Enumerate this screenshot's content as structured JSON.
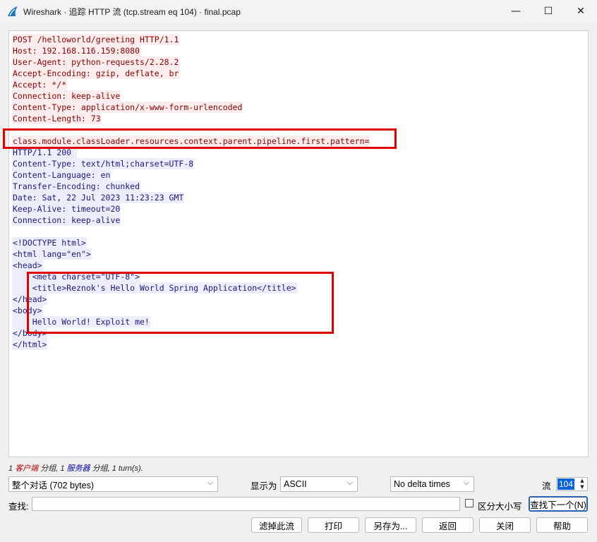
{
  "window": {
    "title": "Wireshark · 追踪 HTTP 流 (tcp.stream eq 104) · final.pcap",
    "controls": {
      "minimize": "—",
      "maximize": "☐",
      "close": "✕"
    }
  },
  "stream": {
    "lines": [
      {
        "text": "POST /helloworld/greeting HTTP/1.1",
        "side": "client"
      },
      {
        "text": "Host: 192.168.116.159:8080",
        "side": "client"
      },
      {
        "text": "User-Agent: python-requests/2.28.2",
        "side": "client"
      },
      {
        "text": "Accept-Encoding: gzip, deflate, br",
        "side": "client"
      },
      {
        "text": "Accept: */*",
        "side": "client"
      },
      {
        "text": "Connection: keep-alive",
        "side": "client"
      },
      {
        "text": "Content-Type: application/x-www-form-urlencoded",
        "side": "client"
      },
      {
        "text": "Content-Length: 73",
        "side": "client"
      },
      {
        "text": "",
        "side": "blank"
      },
      {
        "text": "class.module.classLoader.resources.context.parent.pipeline.first.pattern=",
        "side": "client"
      },
      {
        "text": "HTTP/1.1 200 ",
        "side": "server"
      },
      {
        "text": "Content-Type: text/html;charset=UTF-8",
        "side": "server"
      },
      {
        "text": "Content-Language: en",
        "side": "server"
      },
      {
        "text": "Transfer-Encoding: chunked",
        "side": "server"
      },
      {
        "text": "Date: Sat, 22 Jul 2023 11:23:23 GMT",
        "side": "server"
      },
      {
        "text": "Keep-Alive: timeout=20",
        "side": "server"
      },
      {
        "text": "Connection: keep-alive",
        "side": "server"
      },
      {
        "text": "",
        "side": "blank"
      },
      {
        "text": "<!DOCTYPE html>",
        "side": "server"
      },
      {
        "text": "<html lang=\"en\">",
        "side": "server"
      },
      {
        "text": "<head>",
        "side": "server"
      },
      {
        "text": "    <meta charset=\"UTF-8\">",
        "side": "server"
      },
      {
        "text": "    <title>Reznok's Hello World Spring Application</title>",
        "side": "server"
      },
      {
        "text": "</head>",
        "side": "server"
      },
      {
        "text": "<body>",
        "side": "server"
      },
      {
        "text": "    Hello World! Exploit me!",
        "side": "server"
      },
      {
        "text": "</body>",
        "side": "server"
      },
      {
        "text": "</html>",
        "side": "server"
      }
    ]
  },
  "summary": {
    "client_count": "1",
    "client_label": "客户端",
    "packets1": " 分组, ",
    "server_count": "1",
    "server_label": "服务器",
    "packets2": " 分组, ",
    "turns": "1 turn(s)."
  },
  "controls": {
    "conversation_select": "整个对话 (702 bytes)",
    "show_as_label": "显示为",
    "show_as_value": "ASCII",
    "delta_select": "No delta times",
    "stream_label": "流",
    "stream_value": "104",
    "find_label": "查找:",
    "find_value": "",
    "case_label": "区分大小写",
    "find_next_button": "查找下一个(N)"
  },
  "buttons": {
    "filter_out": "滤掉此流",
    "print": "打印",
    "save_as": "另存为...",
    "back": "返回",
    "close": "关闭",
    "help": "帮助"
  },
  "colors": {
    "client_text": "#8b0000",
    "client_bg": "#fbeded",
    "server_text": "#1a1a7a",
    "server_bg": "#ededfb",
    "annotation": "#e00000"
  }
}
